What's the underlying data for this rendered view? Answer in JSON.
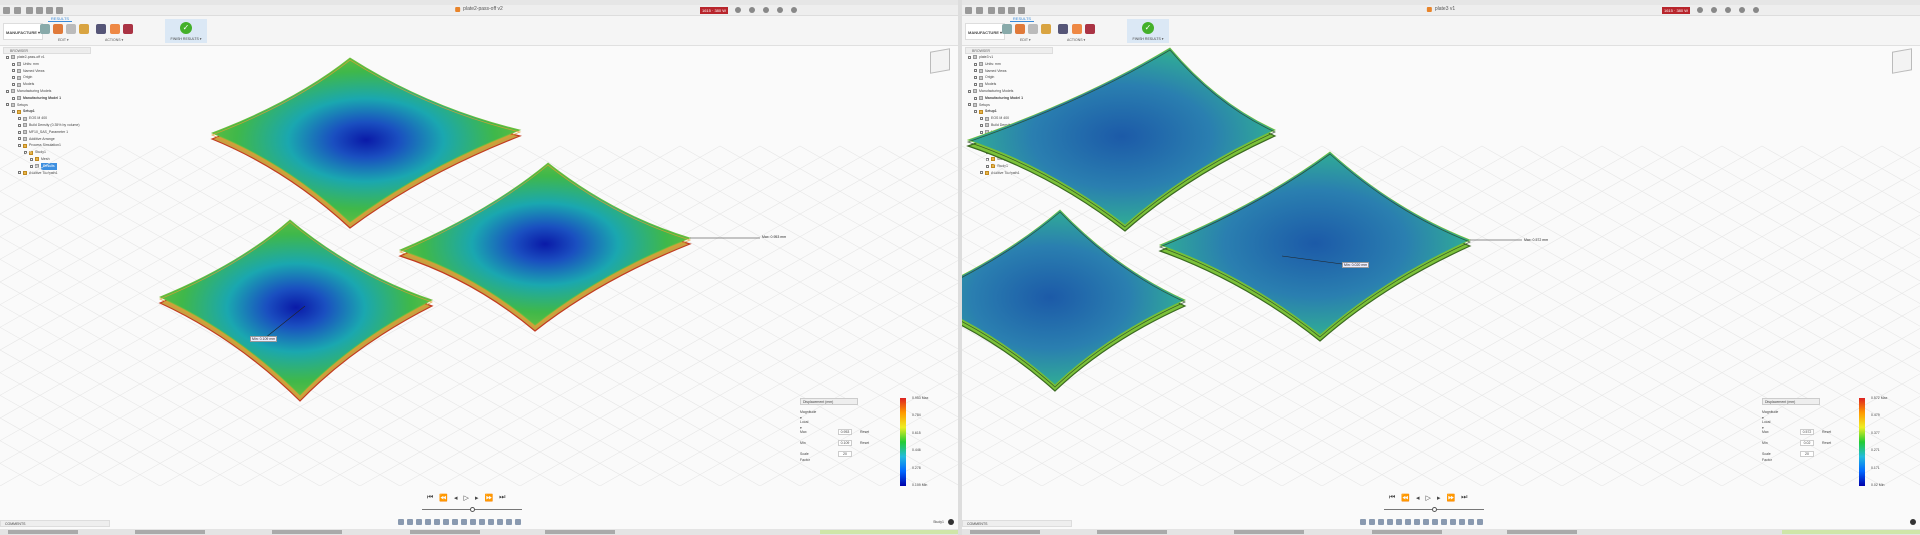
{
  "colors": {
    "quota": "#b8252c",
    "accent": "#3a8ad8",
    "finish_check": "#43b02a",
    "selected": "#3d8fe0"
  },
  "common": {
    "workspace": "MANUFACTURE ▾",
    "ribbon_tab": "RESULTS",
    "groups": {
      "edit": "EDIT ▾",
      "actions": "ACTIONS ▾",
      "finish": "FINISH RESULTS ▾"
    },
    "browser_title": "BROWSER",
    "comments": "COMMENTS",
    "quota": "1615 · 380 W",
    "legend": {
      "type": "Displacement (mm)",
      "component": "Magnitude ▾",
      "scale": "Local ▾",
      "max_label": "Max",
      "min_label": "Min",
      "reset": "Reset",
      "scale_factor_label": "Scale Factor",
      "scale_factor": "20"
    },
    "playback_icons": [
      "skip-start",
      "step-back",
      "prev",
      "play",
      "next",
      "step-forward",
      "skip-end"
    ]
  },
  "left": {
    "doc_title": "plate2-pass-off v2",
    "tree": [
      {
        "label": "plate2-pass-off v1",
        "lvl": 0,
        "ic": "g"
      },
      {
        "label": "Units: mm",
        "lvl": 1,
        "ic": "g"
      },
      {
        "label": "Named Views",
        "lvl": 1,
        "ic": "g"
      },
      {
        "label": "Origin",
        "lvl": 1,
        "ic": "g"
      },
      {
        "label": "Models",
        "lvl": 1,
        "ic": "g"
      },
      {
        "label": "Manufacturing Models",
        "lvl": 0,
        "ic": "g"
      },
      {
        "label": "Manufacturing Model 1",
        "lvl": 1,
        "ic": "g",
        "bold": true
      },
      {
        "label": "Setups",
        "lvl": 0,
        "ic": "g"
      },
      {
        "label": "Setup1",
        "lvl": 1,
        "ic": "f",
        "bold": true
      },
      {
        "label": "EOS M 400",
        "lvl": 2,
        "ic": "g"
      },
      {
        "label": "Build Density (0.35% by volume)",
        "lvl": 2,
        "ic": "g"
      },
      {
        "label": "MF10_SAS_Parameter 1",
        "lvl": 2,
        "ic": "g"
      },
      {
        "label": "Additive Arrange",
        "lvl": 2,
        "ic": "g"
      },
      {
        "label": "Process Simulation1",
        "lvl": 2,
        "ic": "f"
      },
      {
        "label": "Study1",
        "lvl": 3,
        "ic": "f"
      },
      {
        "label": "Mesh",
        "lvl": 4,
        "ic": "f"
      },
      {
        "label": "Results",
        "lvl": 4,
        "ic": "g",
        "sel": true
      },
      {
        "label": "Additive Toolpath1",
        "lvl": 2,
        "ic": "f"
      }
    ],
    "legend": {
      "max": "0.953",
      "min": "0.109",
      "ticks": [
        "0.953 Max",
        "0.784",
        "0.615",
        "0.446",
        "0.278",
        "0.109 Min"
      ]
    },
    "probe_max": "Max: 0.953 mm",
    "probe_min": "Min: 0.109 mm",
    "status": "Study1"
  },
  "right": {
    "doc_title": "plate3 v1",
    "tree": [
      {
        "label": "plate3 v1",
        "lvl": 0,
        "ic": "g"
      },
      {
        "label": "Units: mm",
        "lvl": 1,
        "ic": "g"
      },
      {
        "label": "Named Views",
        "lvl": 1,
        "ic": "g"
      },
      {
        "label": "Origin",
        "lvl": 1,
        "ic": "g"
      },
      {
        "label": "Models",
        "lvl": 1,
        "ic": "g"
      },
      {
        "label": "Manufacturing Models",
        "lvl": 0,
        "ic": "g"
      },
      {
        "label": "Manufacturing Model 1",
        "lvl": 1,
        "ic": "g",
        "bold": true
      },
      {
        "label": "Setups",
        "lvl": 0,
        "ic": "g"
      },
      {
        "label": "Setup1",
        "lvl": 1,
        "ic": "f",
        "bold": true
      },
      {
        "label": "EOS M 400",
        "lvl": 2,
        "ic": "g"
      },
      {
        "label": "Build Density (0.35% by volume)",
        "lvl": 2,
        "ic": "g"
      },
      {
        "label": "MF10_SAS_Parameter 1",
        "lvl": 2,
        "ic": "g"
      },
      {
        "label": "Additive Arrange",
        "lvl": 2,
        "ic": "g"
      },
      {
        "label": "Process Simulation1",
        "lvl": 2,
        "ic": "f"
      },
      {
        "label": "Study1",
        "lvl": 3,
        "ic": "f"
      },
      {
        "label": "Study2",
        "lvl": 3,
        "ic": "f"
      },
      {
        "label": "Study3",
        "lvl": 3,
        "ic": "f"
      },
      {
        "label": "Additive Toolpath1",
        "lvl": 2,
        "ic": "f"
      }
    ],
    "legend": {
      "max": "0.572",
      "min": "0.02",
      "ticks": [
        "0.572 Max",
        "0.479",
        "0.377",
        "0.271",
        "0.171",
        "0.02 Min"
      ]
    },
    "probe_max": "Max: 0.572 mm",
    "probe_min": "Min: 0.020 mm",
    "status": ""
  }
}
